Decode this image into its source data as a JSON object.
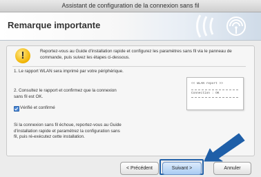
{
  "window": {
    "title": "Assistant de configuration de la connexion sans fil"
  },
  "header": {
    "title": "Remarque importante",
    "logo_icon": "wireless-logo-icon"
  },
  "notice": {
    "icon": "warning-icon",
    "text": "Reportez-vous au Guide d'installation rapide et configurez les paramètres sans fil via le panneau de commande, puis suivez les étapes ci-dessous."
  },
  "steps": {
    "step1": "1. Le rapport WLAN sera imprimé par votre périphérique.",
    "step2": "2. Consultez le rapport et confirmez que la connexion sans fil est OK.",
    "checkbox_label": "Vérifié et confirmé",
    "checkbox_checked": true,
    "failure_text": "Si la connexion sans fil échoue, reportez-vous au Guide d'installation rapide et paramétrez la configuration sans fil, puis ré-exécutez cette installation."
  },
  "report_preview": {
    "line1": "<< WLAN report >>",
    "line2": "Connection : OK"
  },
  "buttons": {
    "back": "< Précédent",
    "next": "Suivant >",
    "cancel": "Annuler"
  },
  "colors": {
    "accent": "#1f5fa8",
    "warning": "#f0b300"
  }
}
